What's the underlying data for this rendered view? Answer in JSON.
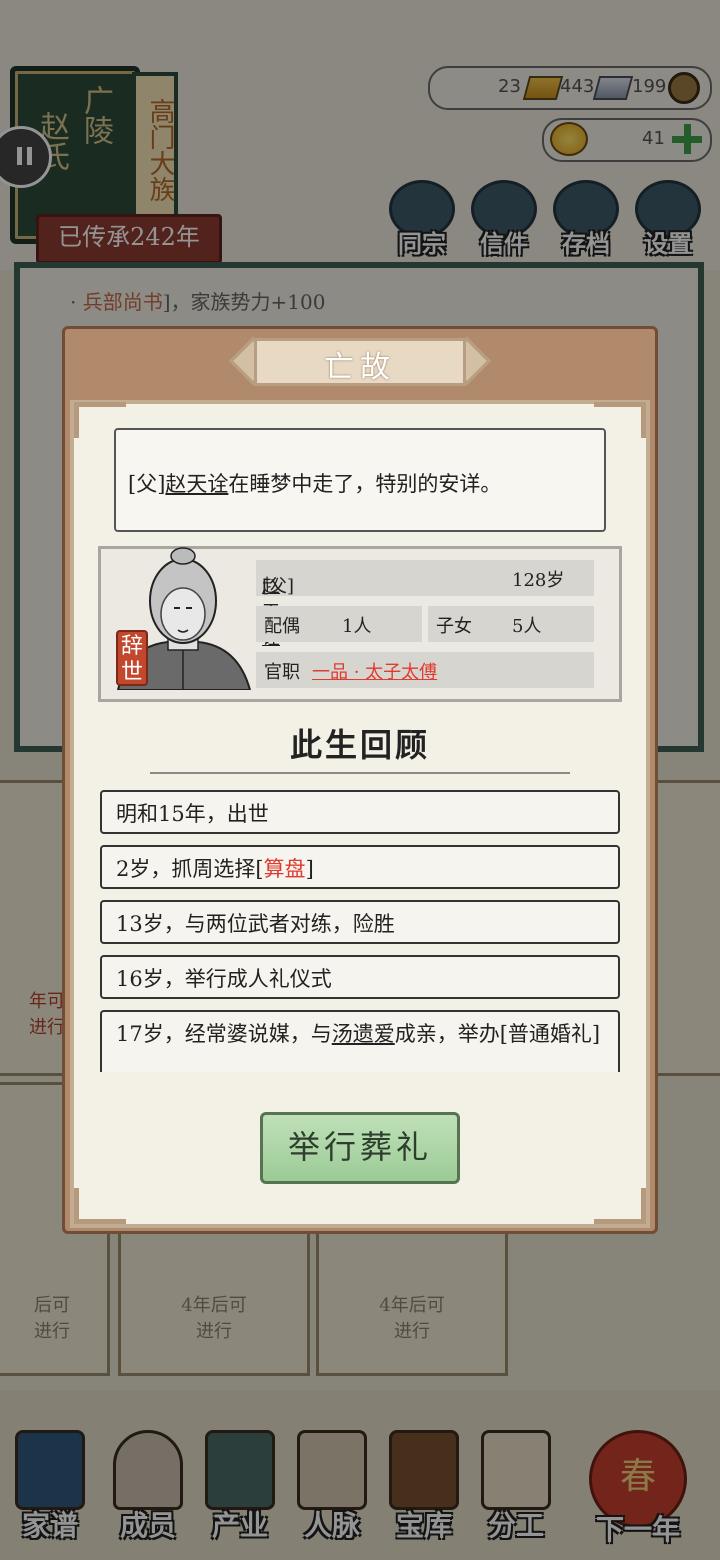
{
  "clan": {
    "region": "广陵",
    "surname": "赵氏",
    "rank": "高门大族",
    "heritage": "已传承242年"
  },
  "resources": {
    "gold": "23",
    "silver": "443",
    "coins": "199",
    "ingots": "41"
  },
  "top_buttons": [
    "同宗",
    "信件",
    "存档",
    "设置"
  ],
  "news": {
    "prefix": "· ",
    "highlight": "兵部尚书",
    "suffix": "]，家族势力+100"
  },
  "side_cards": {
    "left_mid": [
      "年可",
      "进行"
    ],
    "left_bottom": [
      "后可",
      "进行"
    ],
    "card2": [
      "4年后可",
      "进行"
    ],
    "card3": [
      "4年后可",
      "进行"
    ]
  },
  "bottom_nav": [
    "家谱",
    "成员",
    "产业",
    "人脉",
    "宝库",
    "分工",
    "下一年"
  ],
  "newyear_badge": "春",
  "modal": {
    "title": "亡故",
    "message": {
      "relation": "[父]",
      "name": "赵天诠",
      "text": "在睡梦中走了，特别的安详。"
    },
    "person": {
      "relation": "[父]",
      "name": "赵天诠",
      "age": "128岁",
      "spouse_label": "配偶",
      "spouse_value": "1人",
      "children_label": "子女",
      "children_value": "5人",
      "office_label": "官职",
      "office_value": "一品 · 太子太傅",
      "stamp": "辞世"
    },
    "review_title": "此生回顾",
    "life_events": [
      {
        "pre": "明和15年，出世",
        "hl": "",
        "post": ""
      },
      {
        "pre": "2岁，抓周选择[",
        "hl": "算盘",
        "post": "]"
      },
      {
        "pre": "13岁，与两位武者对练，险胜",
        "hl": "",
        "post": ""
      },
      {
        "pre": "16岁，举行成人礼仪式",
        "hl": "",
        "post": ""
      },
      {
        "pre": "17岁，经常婆说媒，与",
        "name": "汤遗爱",
        "post": "成亲，举办[普通婚礼]"
      }
    ],
    "funeral_button": "举行葬礼"
  }
}
